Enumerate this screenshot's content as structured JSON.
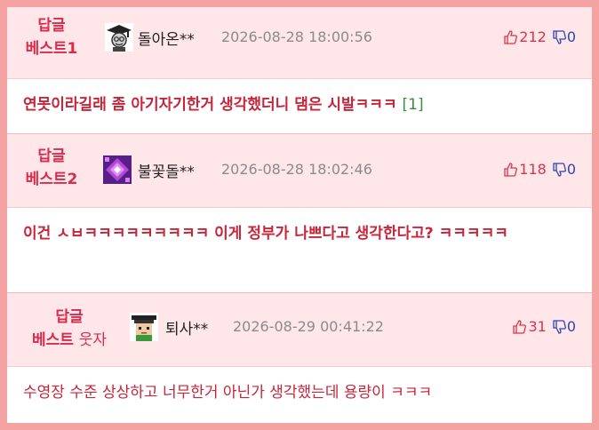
{
  "comments": [
    {
      "label_line1": "답글",
      "label_line2": "베스트1",
      "label_suffix": "",
      "avatar": "graduate-avatar",
      "nick": "돌아온**",
      "date": "2026-08-28 18:00:56",
      "up": "212",
      "down": "0",
      "text": "연못이라길래 좀 아기자기한거 생각했더니 댐은 시발ㅋㅋㅋ",
      "reply_count": "[1]"
    },
    {
      "label_line1": "답글",
      "label_line2": "베스트2",
      "label_suffix": "",
      "avatar": "purple-gem-avatar",
      "nick": "불꽃돌**",
      "date": "2026-08-28 18:02:46",
      "up": "118",
      "down": "0",
      "text": "이건 ㅅㅂㅋㅋㅋㅋㅋㅋㅋㅋㅋ 이게 정부가 나쁘다고 생각한다고? ㅋㅋㅋㅋㅋ",
      "reply_count": ""
    },
    {
      "label_line1": "답글",
      "label_line2": "베스트",
      "label_suffix": "웃자",
      "avatar": "pixel-graduate-avatar",
      "nick": "퇴사**",
      "date": "2026-08-29 00:41:22",
      "up": "31",
      "down": "0",
      "text": "수영장 수준 상상하고 너무한거 아닌가 생각했는데 용량이 ㅋㅋㅋ",
      "reply_count": ""
    }
  ],
  "colors": {
    "accent": "#d92b4d",
    "down": "#2a44b8",
    "frame": "#f4a2a2",
    "header_bg": "#ffe6e8"
  }
}
